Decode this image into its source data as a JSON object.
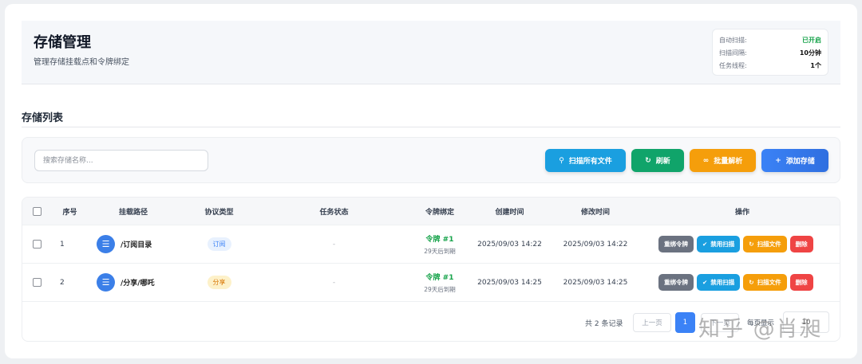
{
  "header": {
    "title": "存储管理",
    "subtitle": "管理存储挂载点和令牌绑定",
    "info": [
      {
        "label": "自动扫描:",
        "value": "已开启",
        "color": "#16a34a"
      },
      {
        "label": "扫描间隔:",
        "value": "10分钟",
        "color": "#111111"
      },
      {
        "label": "任务线程:",
        "value": "1个",
        "color": "#111111"
      }
    ]
  },
  "section_title": "存储列表",
  "toolbar": {
    "search_placeholder": "搜索存储名称...",
    "buttons": [
      {
        "label": "扫描所有文件",
        "icon": "search-icon",
        "color": "#1a9fe0"
      },
      {
        "label": "刷新",
        "icon": "refresh-icon",
        "color": "#10a46a"
      },
      {
        "label": "批量解析",
        "icon": "link-icon",
        "color": "#f59e0b"
      },
      {
        "label": "添加存储",
        "icon": "plus-icon",
        "color": "#3b7cf0"
      }
    ]
  },
  "table": {
    "headers": [
      "序号",
      "挂载路径",
      "协议类型",
      "任务状态",
      "令牌绑定",
      "创建时间",
      "修改时间",
      "操作"
    ],
    "rows": [
      {
        "seq": "1",
        "path": "/订阅目录",
        "protocol": "订阅",
        "protocol_bg": "#e8f1fe",
        "protocol_color": "#3b82f6",
        "status": "-",
        "token": "令牌 #1",
        "token_expiry": "29天后到期",
        "created": "2025/09/03 14:22",
        "modified": "2025/09/03 14:22"
      },
      {
        "seq": "2",
        "path": "/分享/哪吒",
        "protocol": "分享",
        "protocol_bg": "#fdf1c9",
        "protocol_color": "#d97706",
        "status": "-",
        "token": "令牌 #1",
        "token_expiry": "29天后到期",
        "created": "2025/09/03 14:25",
        "modified": "2025/09/03 14:25"
      }
    ],
    "actions": [
      {
        "label": "重绑令牌",
        "color": "#6b7280"
      },
      {
        "label": "禁用扫描",
        "color": "#1a9fe0",
        "icon": "check-circle-icon"
      },
      {
        "label": "扫描文件",
        "color": "#f59e0b",
        "icon": "refresh-icon"
      },
      {
        "label": "删除",
        "color": "#ef4444"
      }
    ]
  },
  "pagination": {
    "total": "共 2 条记录",
    "prev": "上一页",
    "current": "1",
    "next": "下一页",
    "page_size_label": "每页显示",
    "page_size": "10"
  },
  "watermark": "知乎 @肖昶"
}
